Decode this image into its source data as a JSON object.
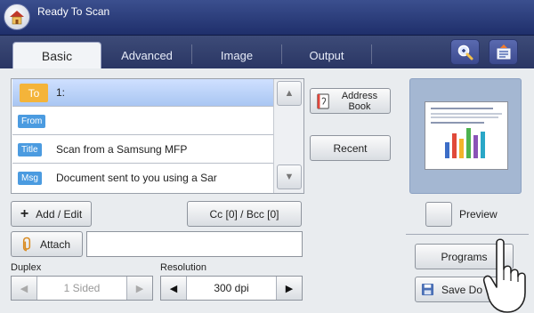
{
  "app": {
    "title": "Ready To Scan"
  },
  "tabs": [
    {
      "label": "Basic"
    },
    {
      "label": "Advanced"
    },
    {
      "label": "Image"
    },
    {
      "label": "Output"
    }
  ],
  "address": {
    "rows": [
      {
        "badge": "To",
        "text": "1:"
      },
      {
        "badge": "From",
        "text": ""
      },
      {
        "badge": "Title",
        "text": "Scan from a Samsung MFP"
      },
      {
        "badge": "Msg",
        "text": "Document sent to you using a Sar"
      }
    ]
  },
  "buttons": {
    "address_book": "Address Book",
    "recent": "Recent",
    "add_edit": "Add / Edit",
    "attach": "Attach",
    "cc": "Cc [0] / Bcc [0]",
    "preview": "Preview",
    "programs": "Programs",
    "save_doc": "Save Do"
  },
  "duplex": {
    "label": "Duplex",
    "value": "1 Sided"
  },
  "resolution": {
    "label": "Resolution",
    "value": "300 dpi"
  },
  "icons": {
    "home": "home-icon",
    "zoom": "zoom-icon",
    "job": "job-status-icon",
    "book": "address-book-icon",
    "clip": "paperclip-icon",
    "disk": "floppy-disk-icon",
    "hand": "hand-pointer-icon"
  },
  "colors": {
    "top_bar": "#2a3a78",
    "to_badge": "#f4b43a",
    "field_badge": "#4b9be0",
    "selection": "#b6cff5"
  }
}
